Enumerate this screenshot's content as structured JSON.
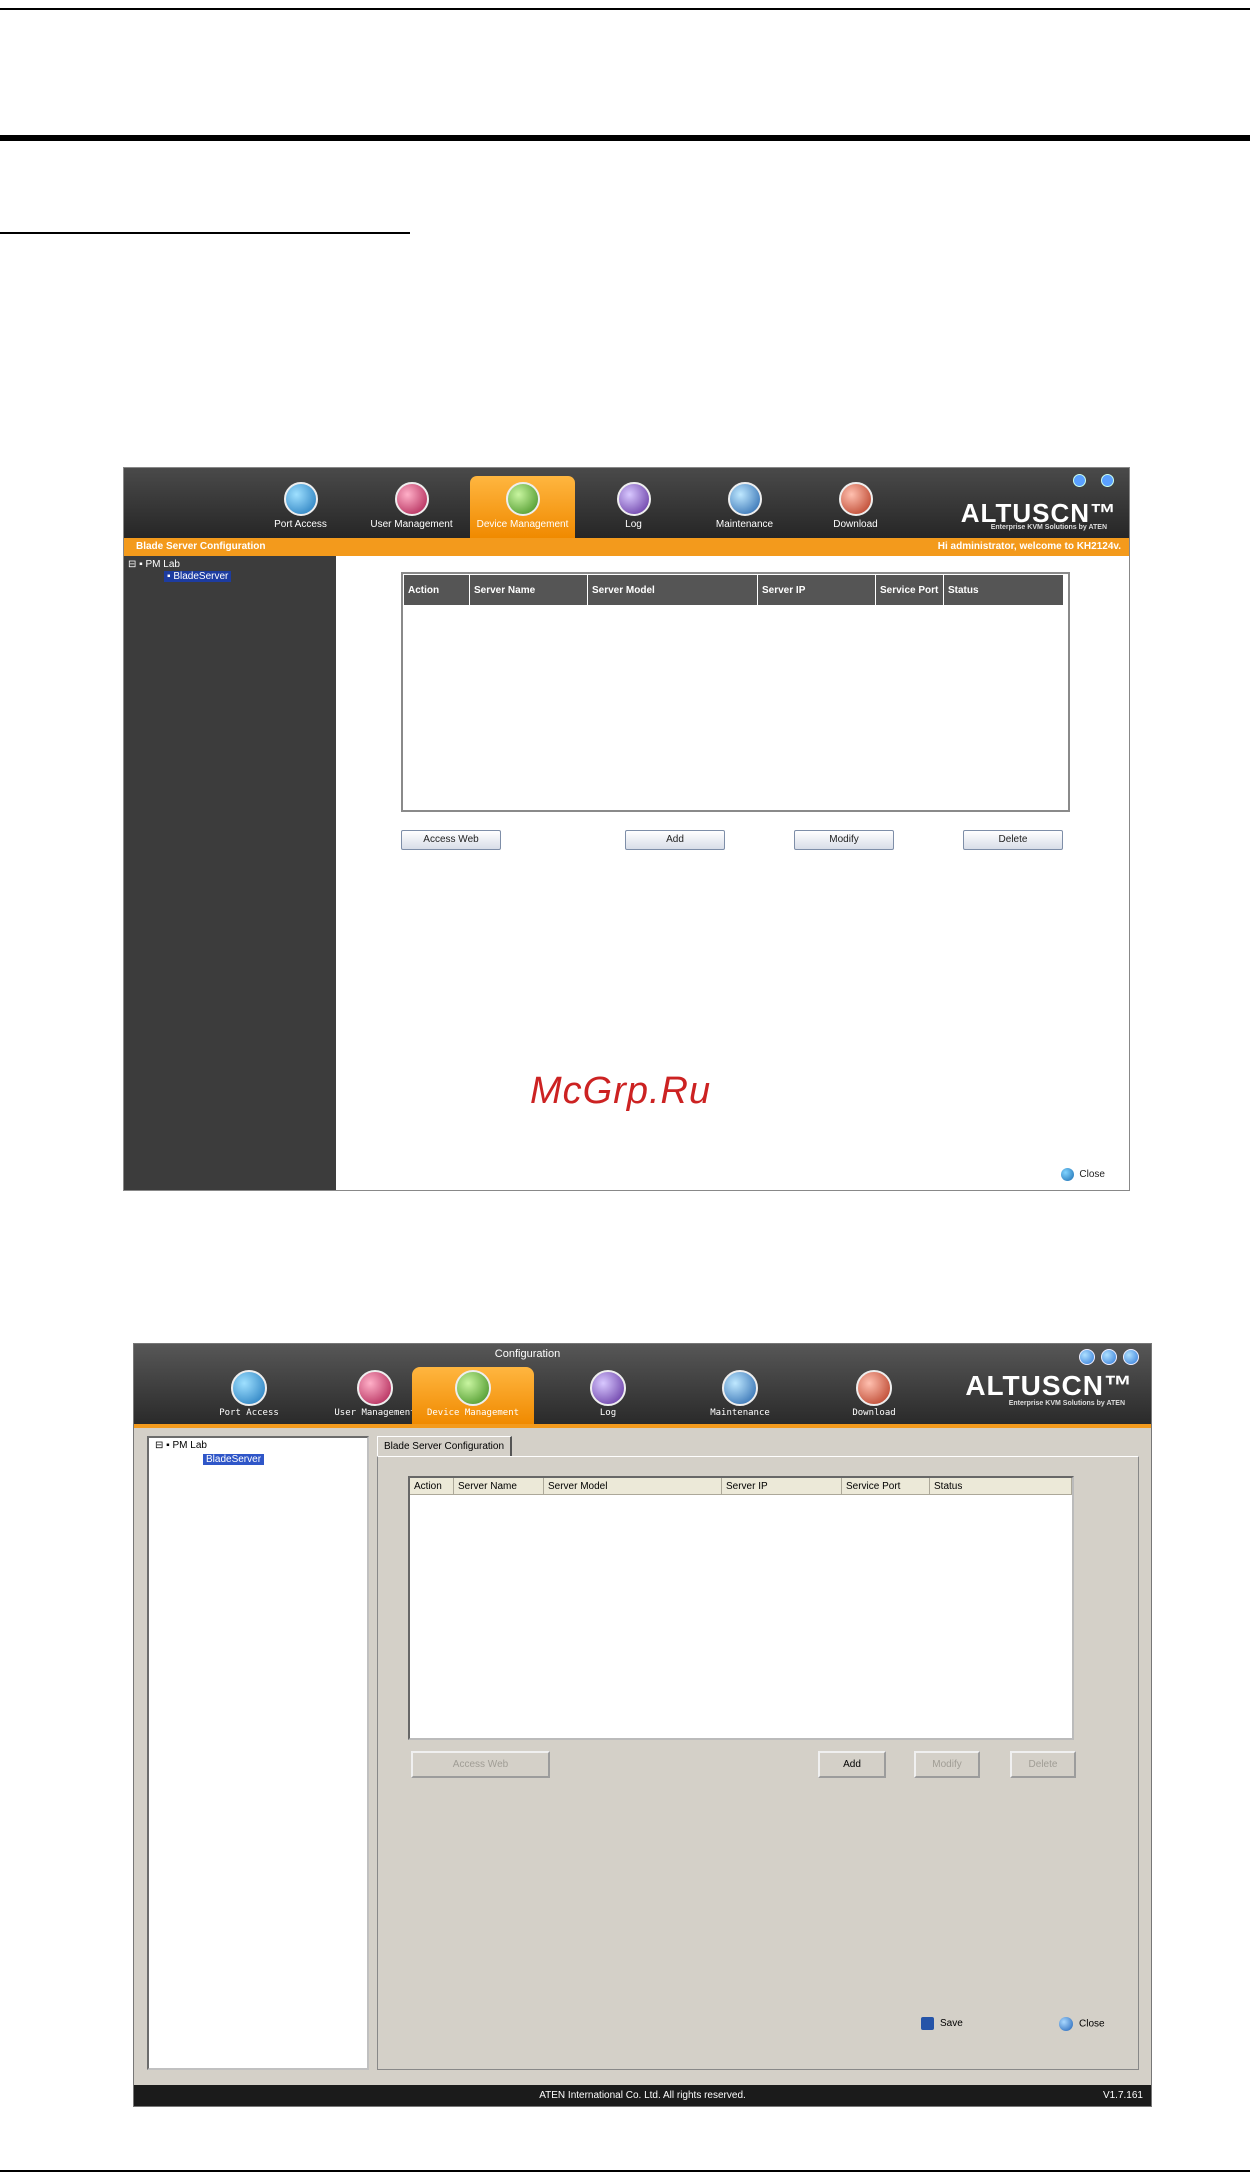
{
  "watermark": "McGrp.Ru",
  "browser_ui": {
    "tabs": [
      {
        "label": "Port Access"
      },
      {
        "label": "User Management"
      },
      {
        "label": "Device Management"
      },
      {
        "label": "Log"
      },
      {
        "label": "Maintenance"
      },
      {
        "label": "Download"
      }
    ],
    "active_tab": "Device Management",
    "logo": "ALTUSCN™",
    "logo_tagline": "Enterprise KVM Solutions by ATEN",
    "page_title": "Blade Server Configuration",
    "welcome": "Hi administrator, welcome to KH2124v.",
    "tree": {
      "root": "PM Lab",
      "child": "BladeServer"
    },
    "table_headers": [
      "Action",
      "Server Name",
      "Server Model",
      "Server IP",
      "Service Port",
      "Status"
    ],
    "buttons": {
      "access_web": "Access Web",
      "add": "Add",
      "modify": "Modify",
      "delete": "Delete"
    },
    "close": "Close"
  },
  "windows_ui": {
    "window_title": "Configuration",
    "tabs": [
      {
        "label": "Port Access"
      },
      {
        "label": "User Management"
      },
      {
        "label": "Device Management"
      },
      {
        "label": "Log"
      },
      {
        "label": "Maintenance"
      },
      {
        "label": "Download"
      }
    ],
    "active_tab": "Device Management",
    "logo": "ALTUSCN™",
    "logo_tagline": "Enterprise KVM Solutions by ATEN",
    "tree": {
      "root": "PM Lab",
      "child": "BladeServer"
    },
    "tab_label": "Blade Server Configuration",
    "table_headers": [
      "Action",
      "Server Name",
      "Server Model",
      "Server IP",
      "Service Port",
      "Status"
    ],
    "buttons": {
      "access_web": "Access Web",
      "add": "Add",
      "modify": "Modify",
      "delete": "Delete"
    },
    "save": "Save",
    "close": "Close",
    "copyright": "ATEN International Co. Ltd. All rights reserved.",
    "version": "V1.7.161"
  },
  "colors": {
    "orange": "#f39a1c",
    "dark_bar": "#2a2a2a",
    "selection": "#1d3ca0"
  }
}
